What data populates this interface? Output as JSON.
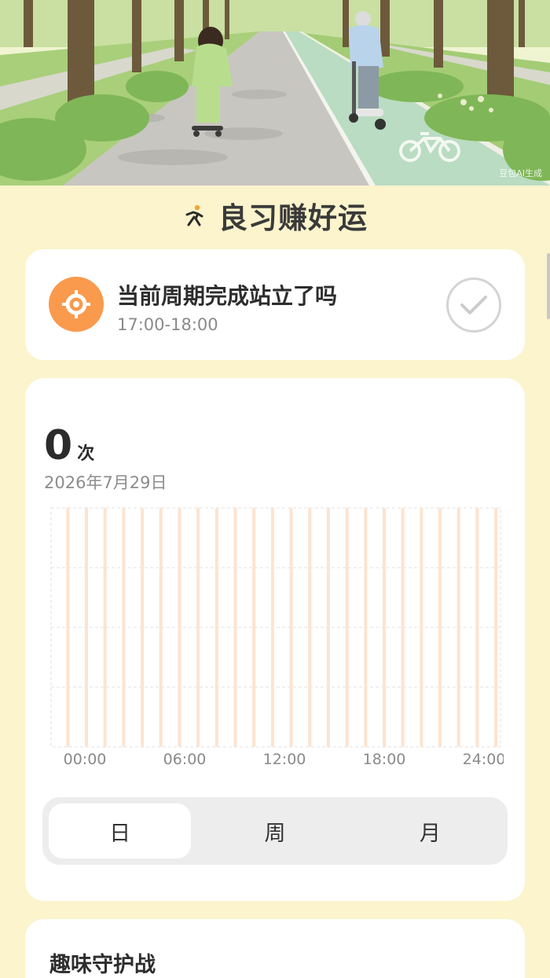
{
  "hero": {
    "watermark": "豆包AI生成"
  },
  "header": {
    "title": "良习赚好运",
    "icon": "runner-icon"
  },
  "task": {
    "title": "当前周期完成站立了吗",
    "time_range": "17:00-18:00",
    "icon": "target-icon",
    "check_icon": "check-circle-icon",
    "accent": "#f99a4d"
  },
  "stats": {
    "count": "0",
    "unit": "次",
    "date": "2026年7月29日"
  },
  "chart_data": {
    "type": "bar",
    "title": "",
    "xlabel": "",
    "ylabel": "",
    "x_ticks": [
      "00:00",
      "06:00",
      "12:00",
      "18:00",
      "24:00"
    ],
    "categories": [
      "0",
      "1",
      "2",
      "3",
      "4",
      "5",
      "6",
      "7",
      "8",
      "9",
      "10",
      "11",
      "12",
      "13",
      "14",
      "15",
      "16",
      "17",
      "18",
      "19",
      "20",
      "21",
      "22",
      "23"
    ],
    "values": [
      0,
      0,
      0,
      0,
      0,
      0,
      0,
      0,
      0,
      0,
      0,
      0,
      0,
      0,
      0,
      0,
      0,
      0,
      0,
      0,
      0,
      0,
      0,
      0
    ],
    "ylim": [
      0,
      4
    ],
    "grid": true,
    "bar_color": "#fde4cf"
  },
  "period_tabs": {
    "items": [
      {
        "label": "日"
      },
      {
        "label": "周"
      },
      {
        "label": "月"
      }
    ],
    "selected": 0
  },
  "guard": {
    "title": "趣味守护战"
  }
}
